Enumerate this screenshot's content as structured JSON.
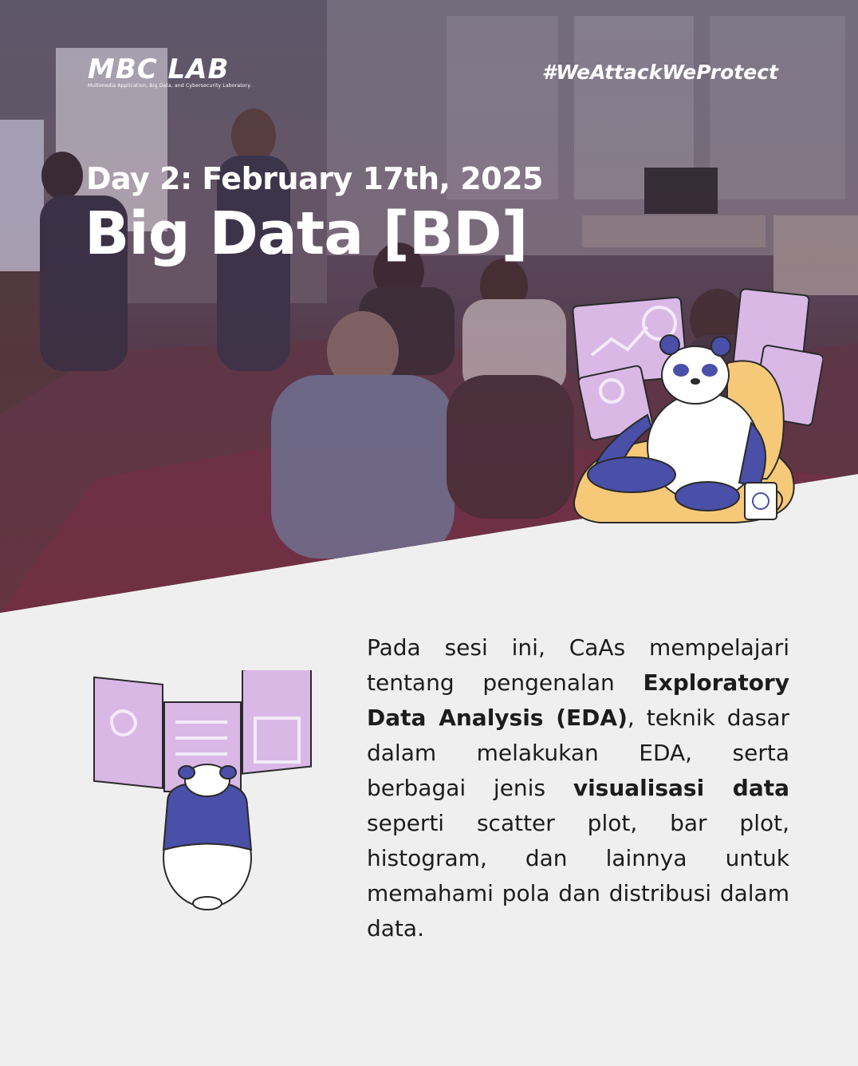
{
  "brand": {
    "logo_text": "MBC LAB",
    "logo_subtitle": "Multimedia Application, Big Data, and Cybersecurity Laboratory.",
    "hashtag": "#WeAttackWeProtect"
  },
  "header": {
    "day_line": "Day 2: February 17th, 2025",
    "title": "Big Data [BD]"
  },
  "description": {
    "p1": "Pada sesi ini, CaAs mempelajari tentang pengenalan ",
    "b1": "Exploratory Data Analysis (EDA)",
    "p2": ", teknik dasar dalam melakukan EDA, serta berbagai jenis ",
    "b2": "visualisasi data",
    "p3": " seperti scatter plot, bar plot, histogram, dan lainnya untuk memahami pola dan distribusi dalam data."
  },
  "colors": {
    "background": "#f0eff0",
    "panda_blue": "#4a4fa8",
    "panel_purple": "#d9b8e6",
    "beanbag": "#f6c979"
  },
  "icons": {
    "hero_photo": "classroom-photo",
    "panda_sitting": "panda-sitting-illustration",
    "panda_back": "panda-back-illustration"
  }
}
